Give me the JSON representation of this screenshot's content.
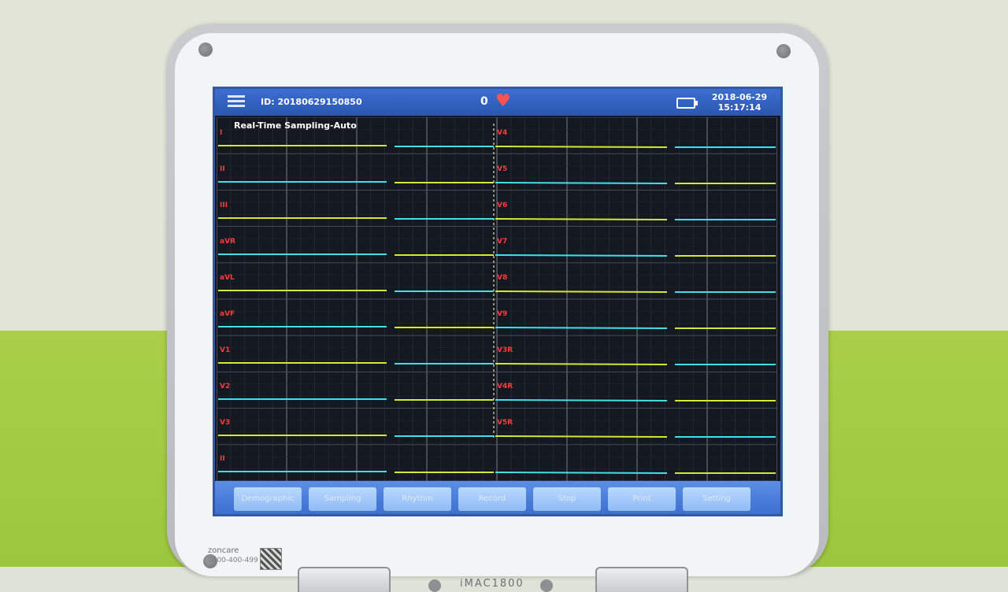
{
  "header": {
    "patient_id": "ID: 20180629150850",
    "heart_rate": "0",
    "date": "2018-06-29",
    "time": "15:17:14"
  },
  "ecg": {
    "mode": "Real-Time Sampling-Auto",
    "left_leads": [
      "I",
      "II",
      "III",
      "aVR",
      "aVL",
      "aVF",
      "V1",
      "V2",
      "V3",
      "II"
    ],
    "right_leads": [
      "V4",
      "V5",
      "V6",
      "V7",
      "V8",
      "V9",
      "V3R",
      "V4R",
      "V5R"
    ],
    "trace_colors": [
      "#d4e830",
      "#3fe0e8"
    ]
  },
  "softkeys": [
    "Demographic",
    "Sampling",
    "Rhythm",
    "Record",
    "Stop",
    "Print",
    "Setting"
  ],
  "device": {
    "model": "iMAC1800",
    "brand": "zoncare",
    "phone": "4000-400-499"
  },
  "icons": [
    "menu-icon",
    "heart-icon",
    "battery-icon"
  ]
}
